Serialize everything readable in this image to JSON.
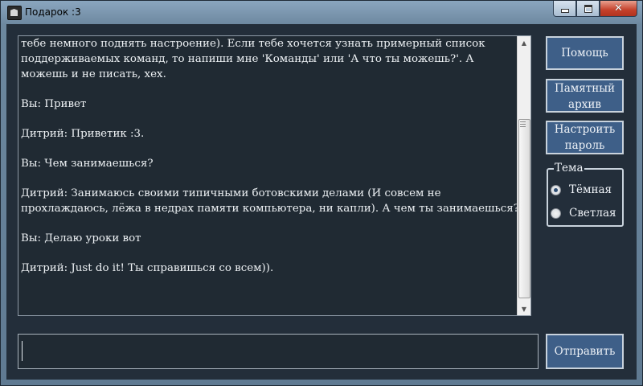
{
  "window": {
    "title": "Подарок :3",
    "icon": "gift-app-icon",
    "controls": [
      "minimize-icon",
      "maximize-icon",
      "close-icon"
    ]
  },
  "chat": {
    "messages": [
      "тебе немного поднять настроение). Если тебе хочется узнать примерный список поддерживаемых команд, то напиши мне 'Команды' или 'А что ты можешь?'. А можешь и не писать, хех.",
      "Вы: Привет",
      "Дитрий: Приветик :3.",
      "Вы: Чем занимаешься?",
      "Дитрий: Занимаюсь своими типичными ботовскими делами (И совсем не прохлаждаюсь, лёжа в недрах памяти компьютера, ни капли). А чем ты занимаешься?",
      "Вы: Делаю уроки вот",
      "Дитрий: Just do it! Ты справишься со всем))."
    ],
    "scroll_position": 0.95
  },
  "sidebar": {
    "help_label": "Помощь",
    "archive_label_line1": "Памятный",
    "archive_label_line2": "архив",
    "password_label_line1": "Настроить",
    "password_label_line2": "пароль",
    "theme": {
      "legend": "Тема",
      "options": [
        {
          "label": "Тёмная",
          "checked": true
        },
        {
          "label": "Светлая",
          "checked": false
        }
      ]
    }
  },
  "input": {
    "value": "",
    "send_label": "Отправить"
  },
  "colors": {
    "background": "#232e3a",
    "chat_background": "#202a33",
    "button": "#3e5f88",
    "text": "#eef2f5"
  }
}
